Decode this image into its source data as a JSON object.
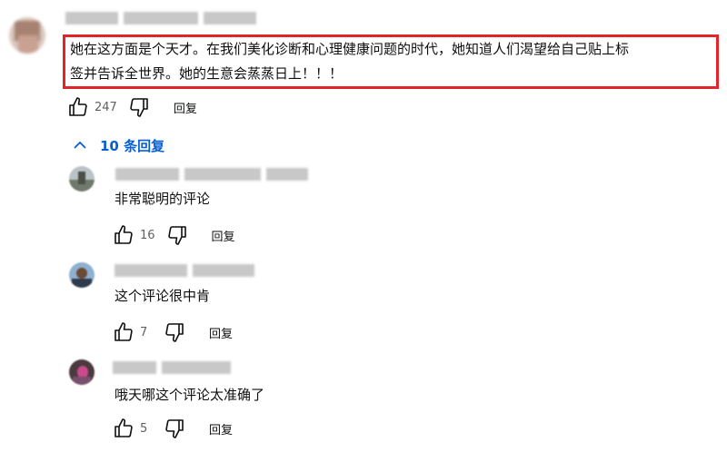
{
  "main_comment": {
    "text_line1": "她在这方面是个天才。在我们美化诊断和心理健康问题的时代，她知道人们渴望给自己贴上标",
    "text_line2": "签并告诉全世界。她的生意会蒸蒸日上！！！",
    "likes": "247",
    "reply_label": "回复"
  },
  "replies_toggle": {
    "label": "10 条回复",
    "icon": "chevron-up-icon"
  },
  "replies": [
    {
      "text": "非常聪明的评论",
      "likes": "16",
      "reply_label": "回复"
    },
    {
      "text": "这个评论很中肯",
      "likes": "7",
      "reply_label": "回复"
    },
    {
      "text": "哦天哪这个评论太准确了",
      "likes": "5",
      "reply_label": "回复"
    }
  ],
  "colors": {
    "highlight_border": "#e3252a",
    "link_blue": "#065fd4",
    "meta_gray": "#606060"
  },
  "icons": [
    "thumb-up-icon",
    "thumb-down-icon",
    "chevron-up-icon"
  ]
}
